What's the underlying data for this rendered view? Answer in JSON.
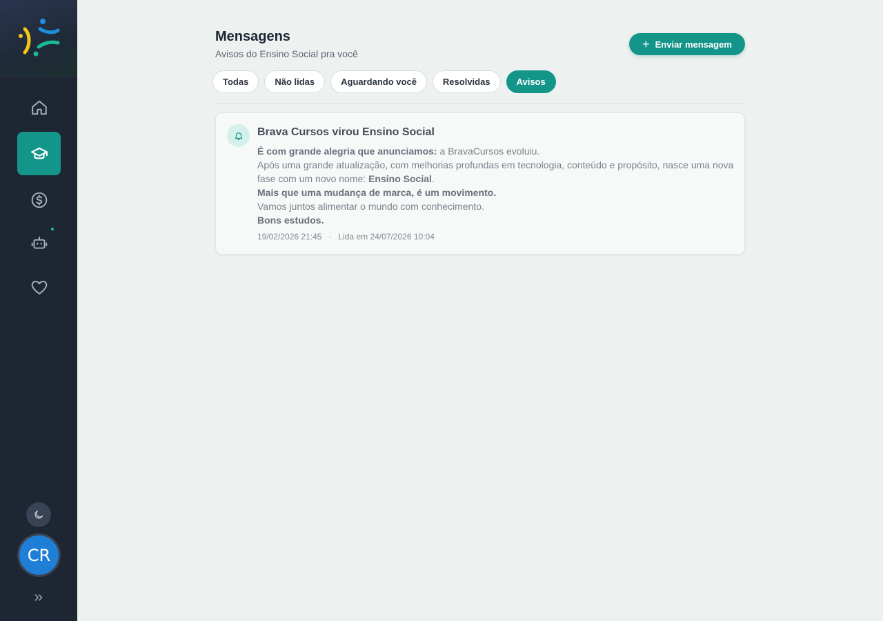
{
  "sidebar": {
    "nav": [
      {
        "icon": "home-icon"
      },
      {
        "icon": "graduation-cap-icon",
        "active": true
      },
      {
        "icon": "dollar-icon"
      },
      {
        "icon": "robot-icon",
        "has_dot": true
      },
      {
        "icon": "heart-icon"
      }
    ],
    "theme_icon": "moon-icon",
    "avatar_initials": "CR",
    "expand_icon": "chevrons-right-icon"
  },
  "header": {
    "title": "Mensagens",
    "subtitle": "Avisos do Ensino Social pra você",
    "send_button_label": "Enviar mensagem"
  },
  "tabs": [
    {
      "label": "Todas"
    },
    {
      "label": "Não lidas"
    },
    {
      "label": "Aguardando você"
    },
    {
      "label": "Resolvidas"
    },
    {
      "label": "Avisos",
      "active": true
    }
  ],
  "message": {
    "icon": "bell-icon",
    "title": "Brava Cursos virou Ensino Social",
    "line1_bold": "É com grande alegria que anunciamos:",
    "line1_rest": " a BravaCursos evoluiu.",
    "line2": "Após uma grande atualização, com melhorias profundas em tecnologia, conteúdo e propósito, nasce uma nova fase com um novo nome: ",
    "line2_bold": "Ensino Social",
    "line2_end": ".",
    "line3_bold": "Mais que uma mudança de marca, é um movimento.",
    "line4": "Vamos juntos alimentar o mundo com conhecimento.",
    "line5_bold": "Bons estudos.",
    "date": "19/02/2026 21:45",
    "separator": "·",
    "read_at": "Lida em 24/07/2026 10:04"
  },
  "colors": {
    "accent": "#14958a",
    "sidebar_bg": "#1e2533",
    "page_bg": "#edf1ef",
    "avatar_bg": "#1f7fd6"
  }
}
